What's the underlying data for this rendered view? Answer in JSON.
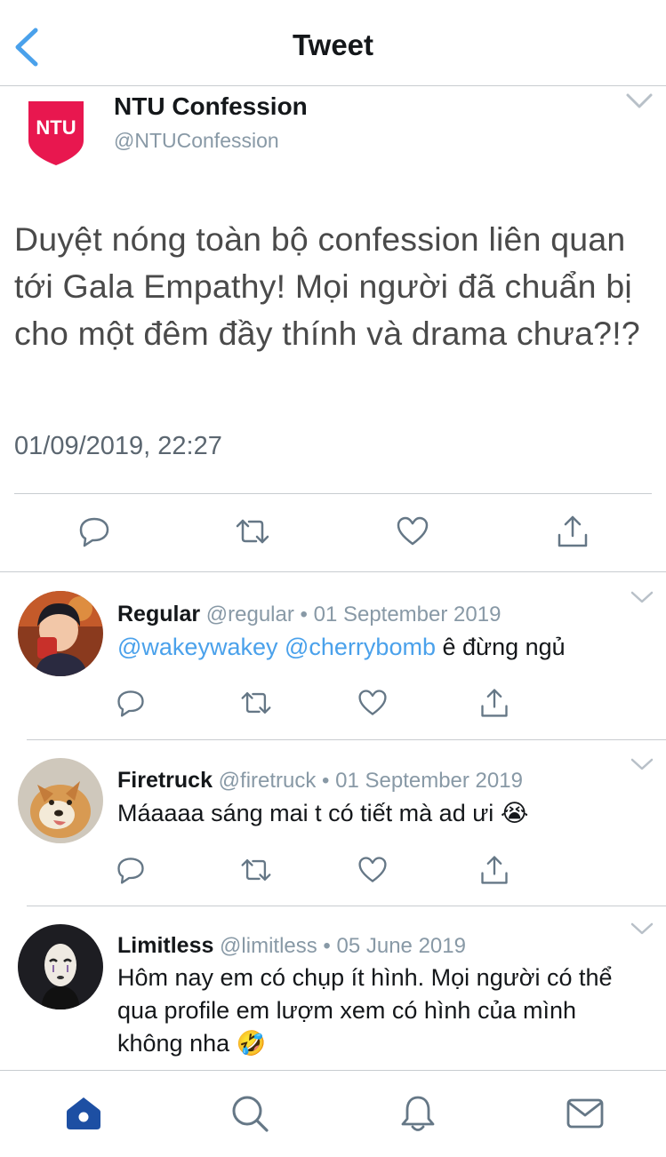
{
  "header": {
    "title": "Tweet",
    "back_icon": "chevron-left-icon"
  },
  "tweet": {
    "logo_text": "NTU",
    "author_name": "NTU Confession",
    "author_handle": "@NTUConfession",
    "text": "Duyệt nóng toàn bộ confession liên quan tới Gala Empathy! Mọi người đã chuẩn bị cho một đêm đầy thính và drama chưa?!?",
    "timestamp": "01/09/2019, 22:27",
    "actions": [
      "reply-icon",
      "retweet-icon",
      "like-icon",
      "share-icon"
    ]
  },
  "replies": [
    {
      "name": "Regular",
      "handle": "@regular",
      "separator": "•",
      "date": "01 September 2019",
      "mention1": "@wakeywakey",
      "mention2": "@cherrybomb",
      "text": " ê đừng ngủ"
    },
    {
      "name": "Firetruck",
      "handle": "@firetruck",
      "separator": "•",
      "date": "01 September 2019",
      "text": "Máaaaa sáng mai t có tiết mà ad ưi",
      "emoji": "😭"
    },
    {
      "name": "Limitless",
      "handle": "@limitless",
      "separator": "•",
      "date": "05 June 2019",
      "text": "Hôm nay em có chụp ít hình. Mọi người có thể qua profile em lượm xem có hình của mình không nha",
      "emoji": "🤣"
    }
  ],
  "tabbar": {
    "tabs": [
      "home-icon",
      "search-icon",
      "notifications-icon",
      "messages-icon"
    ],
    "active": "home-icon"
  },
  "colors": {
    "accent": "#4aa1eb",
    "tab_active": "#1d4fa3",
    "logo": "#e8174f",
    "icon_gray": "#657786"
  }
}
